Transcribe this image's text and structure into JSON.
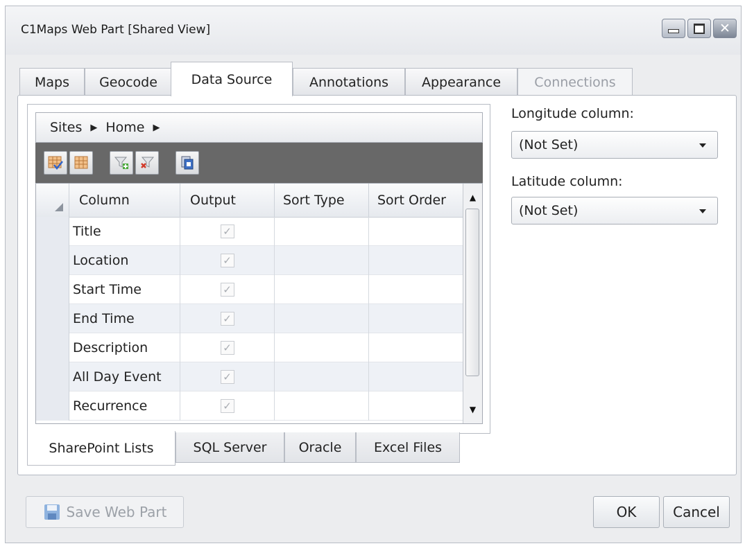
{
  "window": {
    "title": "C1Maps Web Part [Shared View]",
    "controls": [
      "minimize-icon",
      "maximize-icon",
      "close-icon"
    ]
  },
  "tabs": [
    {
      "label": "Maps"
    },
    {
      "label": "Geocode"
    },
    {
      "label": "Data Source",
      "selected": true
    },
    {
      "label": "Annotations"
    },
    {
      "label": "Appearance"
    },
    {
      "label": "Connections",
      "disabled": true
    }
  ],
  "breadcrumb": [
    "Sites",
    "Home"
  ],
  "toolbar": {
    "buttons": [
      "select-all-columns-icon",
      "clear-columns-icon",
      "add-filter-icon",
      "remove-filter-icon",
      "query-icon"
    ]
  },
  "grid": {
    "headers": [
      "Column",
      "Output",
      "Sort Type",
      "Sort Order"
    ],
    "rows": [
      {
        "column": "Title",
        "output": true,
        "sort_type": "",
        "sort_order": ""
      },
      {
        "column": "Location",
        "output": true,
        "sort_type": "",
        "sort_order": ""
      },
      {
        "column": "Start Time",
        "output": true,
        "sort_type": "",
        "sort_order": ""
      },
      {
        "column": "End Time",
        "output": true,
        "sort_type": "",
        "sort_order": ""
      },
      {
        "column": "Description",
        "output": true,
        "sort_type": "",
        "sort_order": ""
      },
      {
        "column": "All Day Event",
        "output": true,
        "sort_type": "",
        "sort_order": ""
      },
      {
        "column": "Recurrence",
        "output": true,
        "sort_type": "",
        "sort_order": ""
      }
    ]
  },
  "source_tabs": [
    {
      "label": "SharePoint Lists",
      "selected": true
    },
    {
      "label": "SQL Server"
    },
    {
      "label": "Oracle"
    },
    {
      "label": "Excel Files"
    }
  ],
  "longitude": {
    "label": "Longitude column:",
    "value": "(Not Set)"
  },
  "latitude": {
    "label": "Latitude column:",
    "value": "(Not Set)"
  },
  "footer": {
    "save_label": "Save Web Part",
    "ok_label": "OK",
    "cancel_label": "Cancel"
  },
  "colors": {
    "toolbar_bg": "#686868",
    "alt_row": "#eef1f6",
    "disabled_text": "#9a9ea6"
  }
}
